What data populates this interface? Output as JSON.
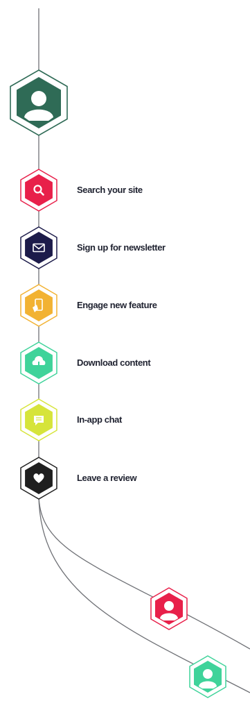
{
  "steps": [
    {
      "label": "Search your site",
      "icon": "search-icon",
      "color": "#e8204a"
    },
    {
      "label": "Sign up for newsletter",
      "icon": "envelope-icon",
      "color": "#1c1b4a"
    },
    {
      "label": "Engage new feature",
      "icon": "mobile-tap-icon",
      "color": "#f2b232"
    },
    {
      "label": "Download content",
      "icon": "cloud-download-icon",
      "color": "#3fd39a"
    },
    {
      "label": "In-app chat",
      "icon": "chat-bubble-icon",
      "color": "#d6e43a"
    },
    {
      "label": "Leave a review",
      "icon": "heart-icon",
      "color": "#1f1f1f"
    }
  ],
  "colors": {
    "primary_user": "#2f6b56",
    "user_red": "#e8204a",
    "user_green": "#3fd39a",
    "line": "#6f7176"
  }
}
